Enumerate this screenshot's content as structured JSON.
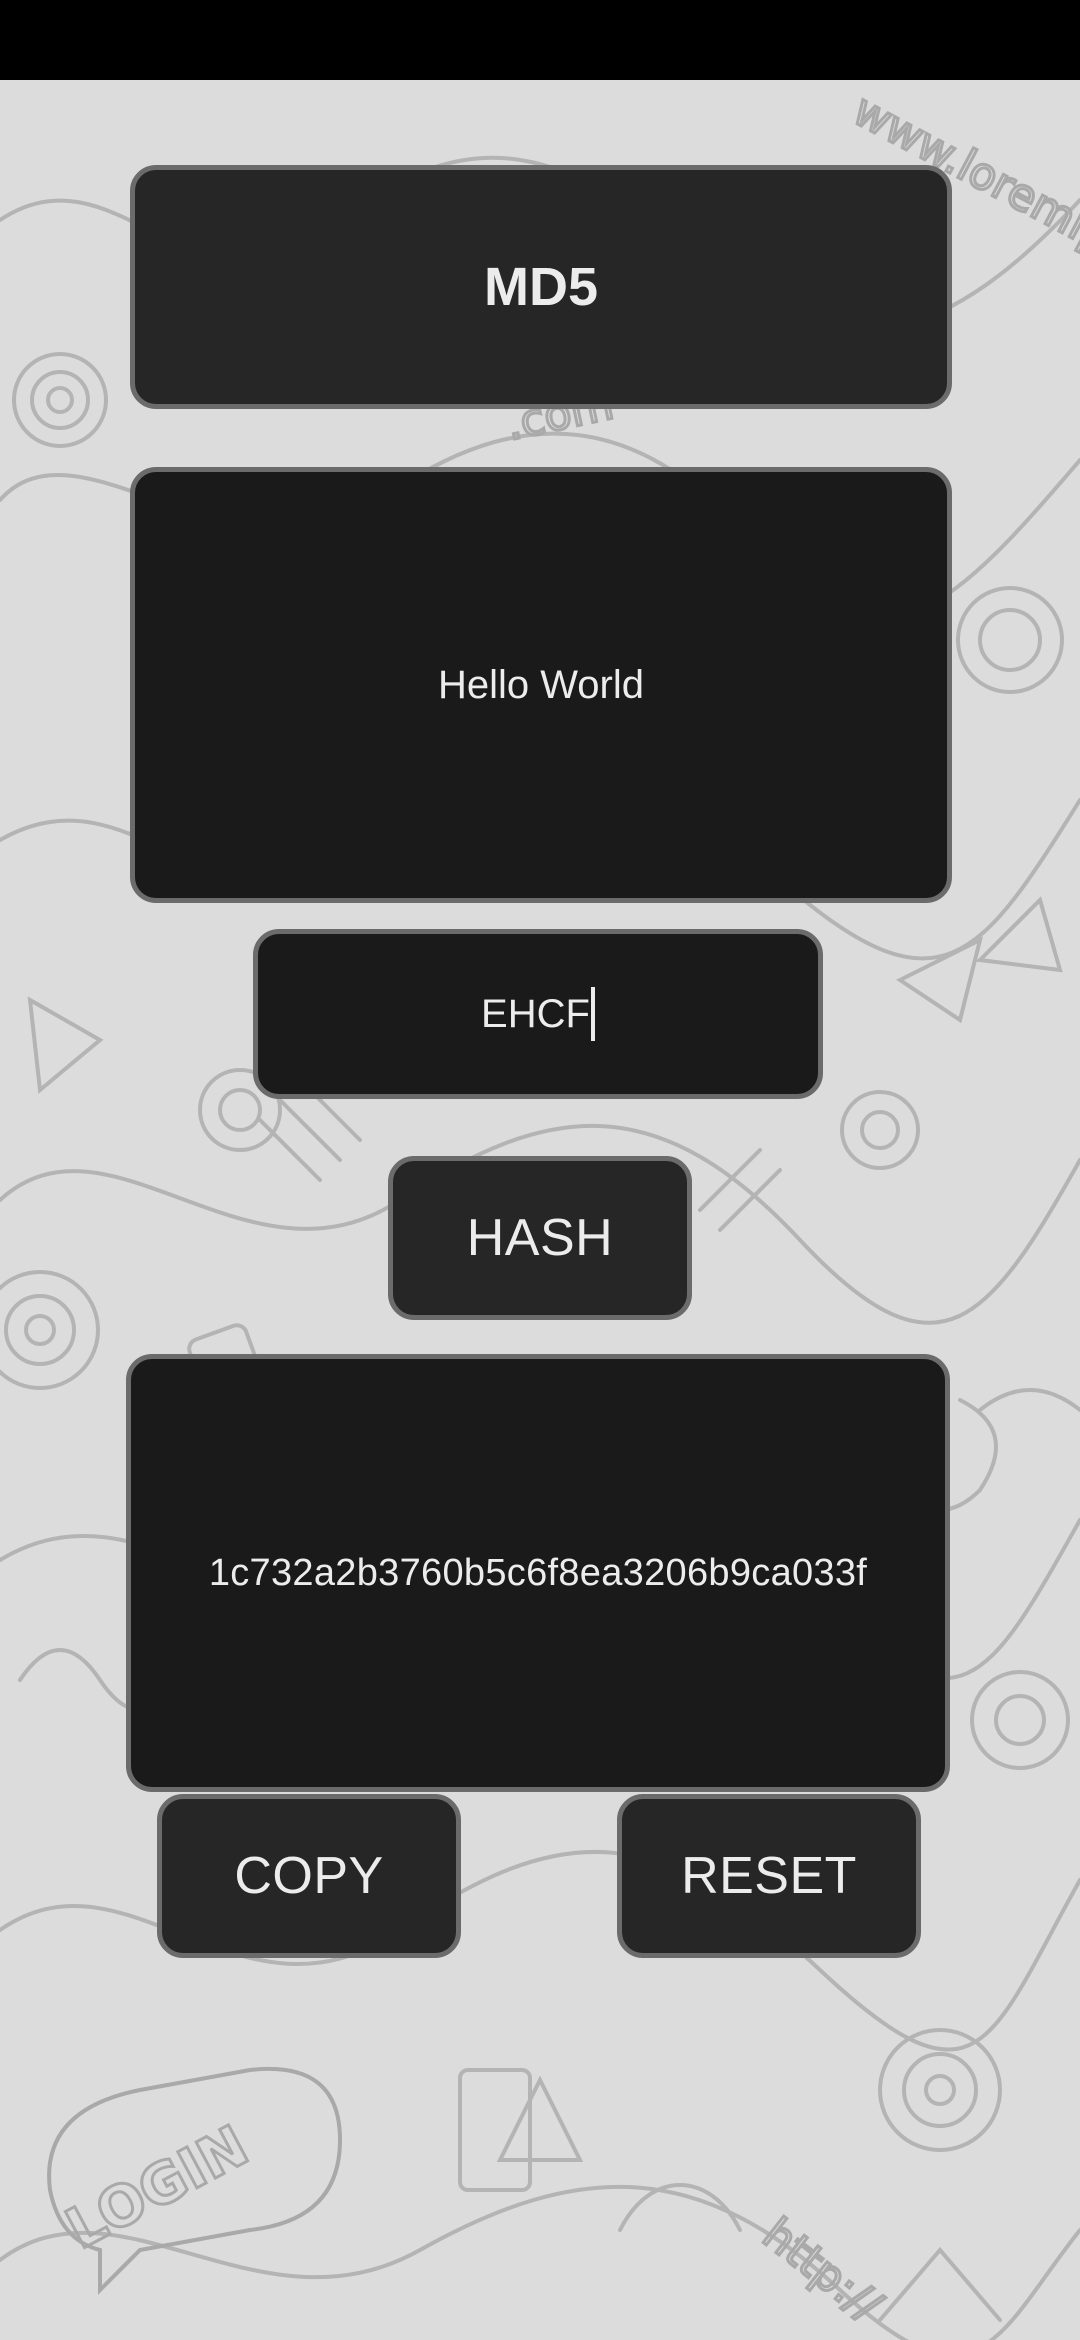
{
  "header": {
    "algorithm_label": "MD5"
  },
  "input": {
    "text_value": "Hello World"
  },
  "key": {
    "value": "EHCF"
  },
  "actions": {
    "hash_label": "HASH",
    "copy_label": "COPY",
    "reset_label": "RESET"
  },
  "output": {
    "hash_value": "1c732a2b3760b5c6f8ea3206b9ca033f"
  },
  "background": {
    "doodle_words": [
      "www.loremipsum.com",
      ".com",
      "LOGIN",
      "http://"
    ]
  },
  "colors": {
    "status_bar": "#000000",
    "background": "#dcdcdc",
    "doodle_stroke": "#a9a9a9",
    "card_button": "#262626",
    "card_field": "#1a1a1a",
    "border": "#6b6b6b",
    "text": "#ececec"
  }
}
